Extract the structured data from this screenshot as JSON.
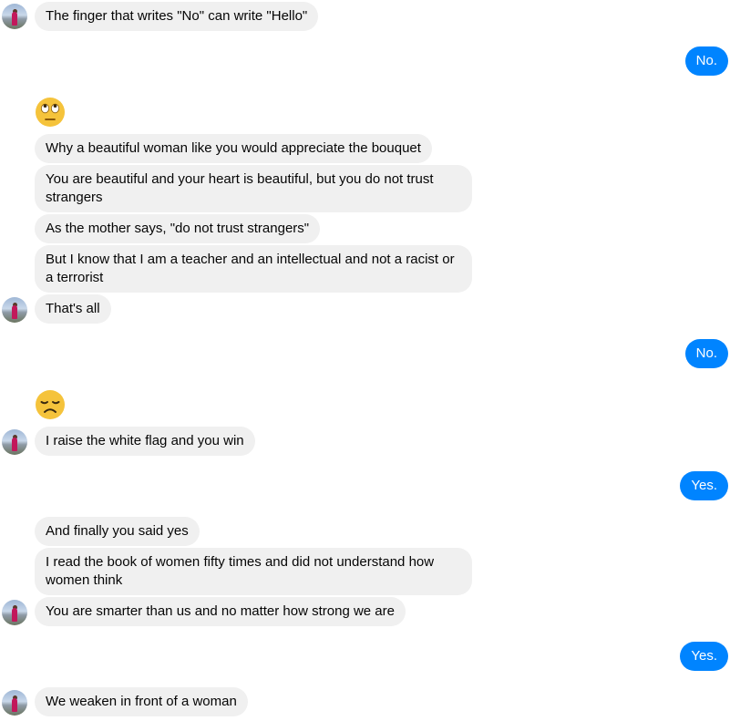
{
  "colors": {
    "incoming_bubble": "#f0f0f0",
    "outgoing_bubble": "#0084ff",
    "emoji_face": "#f5c33b"
  },
  "messages": {
    "m1": "The finger that writes \"No\" can write \"Hello\"",
    "m2": "No.",
    "m3_emoji": "face-with-rolling-eyes-icon",
    "m4": "Why a beautiful woman like you would appreciate the bouquet",
    "m5": "You are beautiful and your heart is beautiful, but you do not trust strangers",
    "m6": "As the mother says, \"do not trust strangers\"",
    "m7": "But I know that I am a teacher and an intellectual and not a racist or a terrorist",
    "m8": "That's all",
    "m9": "No.",
    "m10_emoji": "disappointed-face-icon",
    "m11": "I raise the white flag and you win",
    "m12": "Yes.",
    "m13": "And finally you  said yes",
    "m14": "I read the book of women fifty times and did not understand how women think",
    "m15": "You are smarter than us and no matter how strong we are",
    "m16": "Yes.",
    "m17": "We weaken in front of a woman"
  }
}
